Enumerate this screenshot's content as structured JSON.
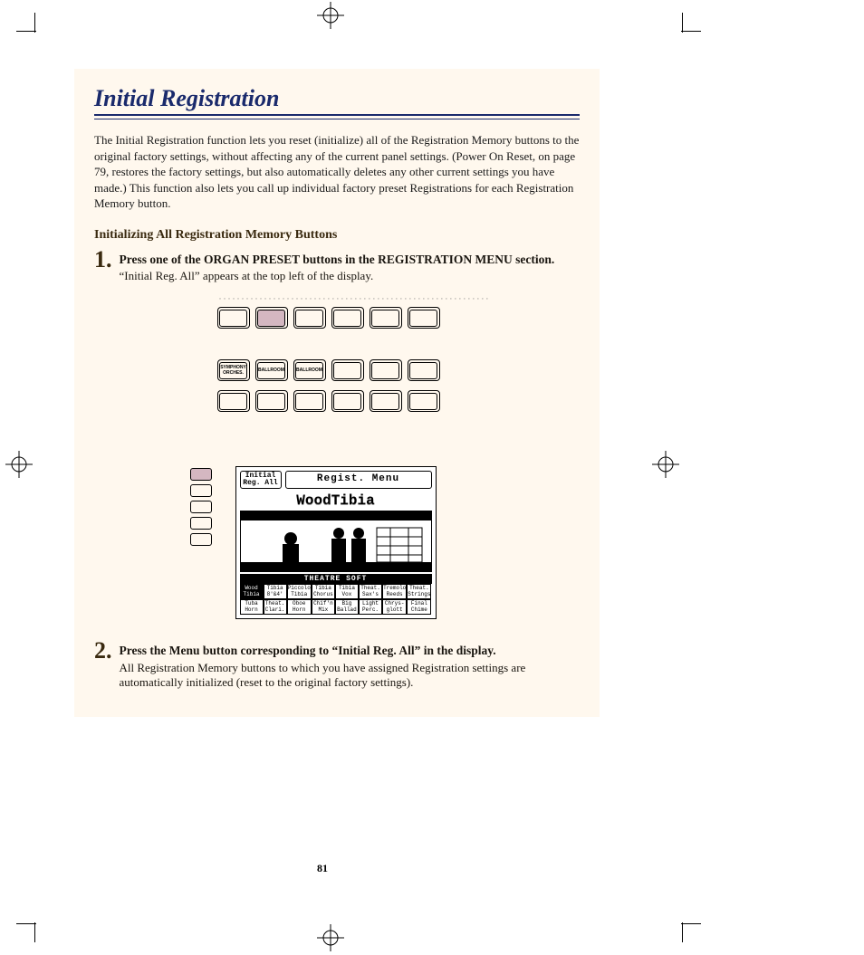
{
  "title": "Initial Registration",
  "intro": "The Initial Registration function lets you reset (initialize) all of the Registration Memory buttons to the original factory settings, without affecting any of the current panel settings.  (Power On Reset, on page 79, restores the factory settings, but also automatically deletes any other current settings you have made.)  This function also lets you call up individual factory preset Registrations for each Registration Memory button.",
  "subhead": "Initializing All Registration Memory Buttons",
  "steps": [
    {
      "num": "1.",
      "bold": "Press one of the ORGAN PRESET buttons in the REGISTRATION MENU section.",
      "body": "“Initial Reg. All” appears at the top left of the display."
    },
    {
      "num": "2.",
      "bold": "Press the Menu button corresponding to “Initial Reg. All” in the display.",
      "body": "All Registration Memory buttons to which you have assigned Registration settings are automatically initialized (reset to the original factory settings)."
    }
  ],
  "preset_labels": {
    "row2": [
      "SYMPHONY ORCHES.",
      "BALLROOM",
      "BALLROOM",
      "",
      "",
      ""
    ]
  },
  "lcd": {
    "pill_small": "Initial Reg. All",
    "pill_big": "Regist. Menu",
    "voice_title": "WoodTibia",
    "category": "THEATRE SOFT",
    "grid": [
      [
        "Wood Tibia",
        "Tibia 8'&4'",
        "Piccolo Tibia",
        "Tibia Chorus",
        "Tibia Vox",
        "Theat. Sax's",
        "Tremolo Reeds",
        "Theat. Strings"
      ],
      [
        "Tuba Horn",
        "Theat. Clari.",
        "Oboe Horn",
        "Chif'n Mix",
        "Big Ballad",
        "Light Perc.",
        "Chrys- glott",
        "Final Chime"
      ]
    ],
    "selected": [
      0,
      0
    ]
  },
  "page_number": "81"
}
